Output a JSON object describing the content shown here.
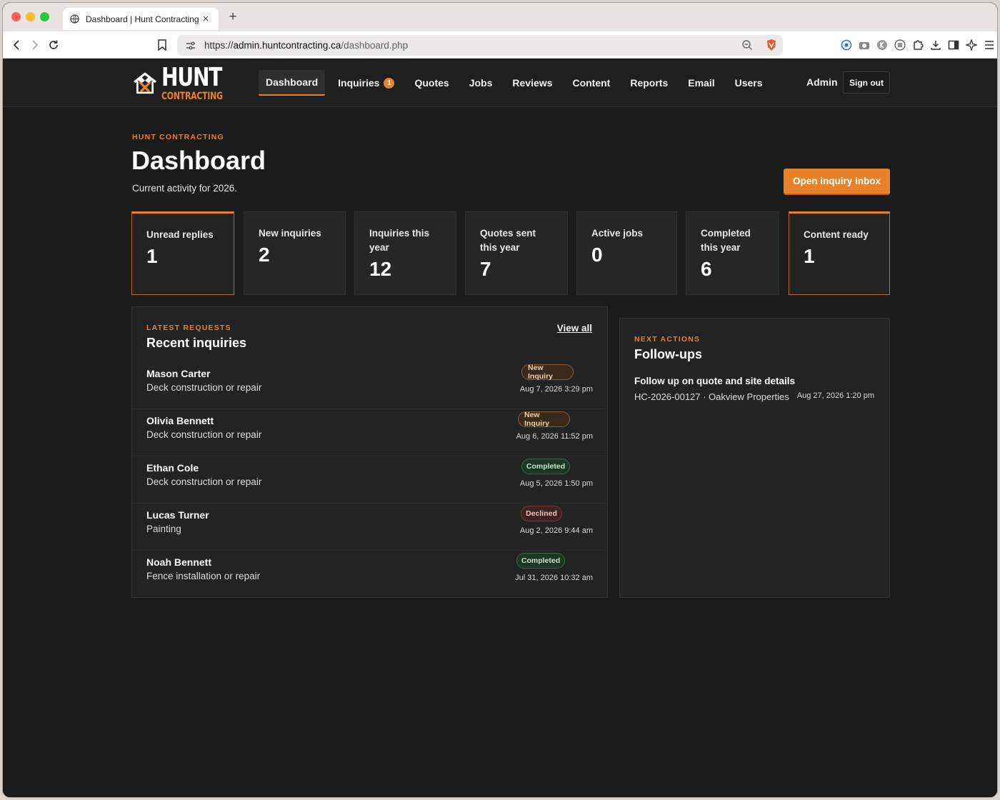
{
  "browser": {
    "tab_title": "Dashboard | Hunt Contracting",
    "url_prefix": "https://",
    "url_host": "admin.huntcontracting.ca",
    "url_path": "/dashboard.php"
  },
  "brand": {
    "line1": "HUNT",
    "line2": "CONTRACTING",
    "accent": "#e8822a"
  },
  "nav": {
    "items": [
      {
        "label": "Dashboard"
      },
      {
        "label": "Inquiries",
        "badge": "1"
      },
      {
        "label": "Quotes"
      },
      {
        "label": "Jobs"
      },
      {
        "label": "Reviews"
      },
      {
        "label": "Content"
      },
      {
        "label": "Reports"
      },
      {
        "label": "Email"
      },
      {
        "label": "Users"
      }
    ],
    "user": "Admin",
    "signout": "Sign out"
  },
  "header": {
    "eyebrow": "HUNT CONTRACTING",
    "title": "Dashboard",
    "subtitle": "Current activity for 2026.",
    "cta": "Open inquiry inbox"
  },
  "stats": [
    {
      "label": "Unread replies",
      "value": "1"
    },
    {
      "label": "New inquiries",
      "value": "2"
    },
    {
      "label": "Inquiries this year",
      "value": "12"
    },
    {
      "label": "Quotes sent this year",
      "value": "7"
    },
    {
      "label": "Active jobs",
      "value": "0"
    },
    {
      "label": "Completed this year",
      "value": "6"
    },
    {
      "label": "Content ready",
      "value": "1"
    }
  ],
  "recent": {
    "eyebrow": "LATEST REQUESTS",
    "title": "Recent inquiries",
    "view_all": "View all",
    "rows": [
      {
        "name": "Mason Carter",
        "service": "Deck construction or repair",
        "status": "New Inquiry",
        "date": "Aug 7, 2026 3:29 pm"
      },
      {
        "name": "Olivia Bennett",
        "service": "Deck construction or repair",
        "status": "New Inquiry",
        "date": "Aug 6, 2026 11:52 pm"
      },
      {
        "name": "Ethan Cole",
        "service": "Deck construction or repair",
        "status": "Completed",
        "date": "Aug 5, 2026 1:50 pm"
      },
      {
        "name": "Lucas Turner",
        "service": "Painting",
        "status": "Declined",
        "date": "Aug 2, 2026 9:44 am"
      },
      {
        "name": "Noah Bennett",
        "service": "Fence installation or repair",
        "status": "Completed",
        "date": "Jul 31, 2026 10:32 am"
      }
    ]
  },
  "followups": {
    "eyebrow": "NEXT ACTIONS",
    "title": "Follow-ups",
    "item": {
      "title": "Follow up on quote and site details",
      "meta": "HC-2026-00127 · Oakview Properties",
      "date": "Aug 27, 2026 1:20 pm"
    }
  }
}
